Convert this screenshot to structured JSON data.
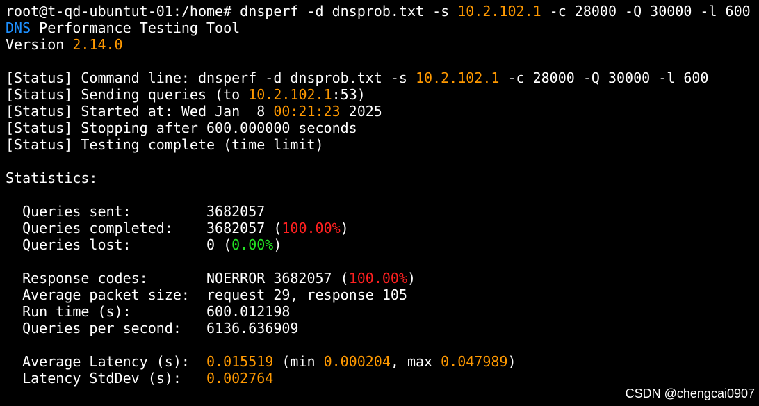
{
  "colors": {
    "background": "#000000",
    "text": "#ffffff",
    "orange": "#ff9900",
    "blue": "#1e90ff",
    "red": "#ff2020",
    "green": "#22e222"
  },
  "prompt": {
    "text": "root@t-qd-ubuntut-01:/home# dnsperf -d dnsprob.txt -s ",
    "server": "10.2.102.1",
    "args": " -c 28000 -Q 30000 -l 600"
  },
  "header": {
    "dns": "DNS",
    "title_rest": " Performance Testing Tool",
    "version_label": "Version ",
    "version": "2.14.0"
  },
  "status": {
    "cmd_prefix": "[Status] Command line: dnsperf -d dnsprob.txt -s ",
    "cmd_server": "10.2.102.1",
    "cmd_args": " -c 28000 -Q 30000 -l 600",
    "send_prefix": "[Status] Sending queries (to ",
    "send_server": "10.2.102.1",
    "send_suffix": ":53)",
    "start_prefix": "[Status] Started at: Wed Jan  8 ",
    "start_time": "00:21:23",
    "start_suffix": " 2025",
    "stopping": "[Status] Stopping after 600.000000 seconds",
    "complete": "[Status] Testing complete (time limit)"
  },
  "statistics": {
    "heading": "Statistics:",
    "sent_label": "  Queries sent:         ",
    "sent_value": "3682057",
    "completed_label": "  Queries completed:    ",
    "completed_value": "3682057 (",
    "completed_pct": "100.00%",
    "completed_close": ")",
    "lost_label": "  Queries lost:         ",
    "lost_value": "0 (",
    "lost_pct": "0.00%",
    "lost_close": ")",
    "rcodes_label": "  Response codes:       ",
    "rcodes_value": "NOERROR 3682057 (",
    "rcodes_pct": "100.00%",
    "rcodes_close": ")",
    "pkt_label": "  Average packet size:  ",
    "pkt_value": "request 29, response 105",
    "runtime_label": "  Run time (s):         ",
    "runtime_value": "600.012198",
    "qps_label": "  Queries per second:   ",
    "qps_value": "6136.636909",
    "avglat_label": "  Average Latency (s):  ",
    "avglat_value": "0.015519",
    "avglat_min_label": " (min ",
    "avglat_min": "0.000204",
    "avglat_max_label": ", max ",
    "avglat_max": "0.047989",
    "avglat_close": ")",
    "stddev_label": "  Latency StdDev (s):   ",
    "stddev_value": "0.002764"
  },
  "watermark": "CSDN @chengcai0907"
}
